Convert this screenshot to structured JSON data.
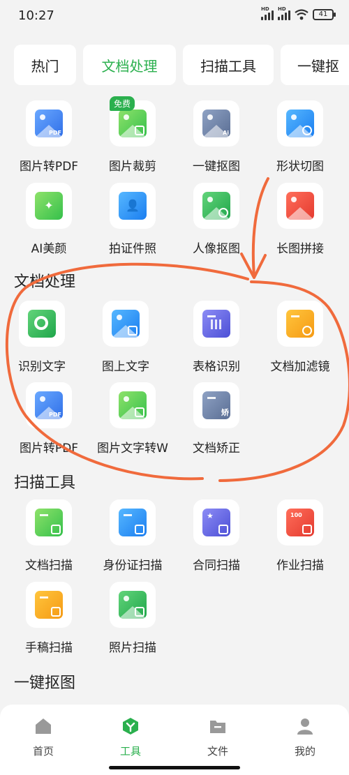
{
  "status_bar": {
    "time": "10:27",
    "signal1": "HD",
    "signal2": "HD",
    "battery": "41"
  },
  "tabs": [
    {
      "label": "热门",
      "active": false
    },
    {
      "label": "文档处理",
      "active": true
    },
    {
      "label": "扫描工具",
      "active": false
    },
    {
      "label": "一键抠",
      "active": false
    }
  ],
  "sections": {
    "doc_processing": "文档处理",
    "scan_tools": "扫描工具",
    "one_click_cutout": "一键抠图"
  },
  "hot_tools": [
    {
      "label": "图片转PDF",
      "mark": "PDF"
    },
    {
      "label": "图片裁剪",
      "badge": "免费"
    },
    {
      "label": "一键抠图",
      "mark": "Ai"
    },
    {
      "label": "形状切图"
    },
    {
      "label": "AI美颜"
    },
    {
      "label": "拍证件照"
    },
    {
      "label": "人像抠图"
    },
    {
      "label": "长图拼接"
    }
  ],
  "doc_tools": [
    {
      "label": "识别文字"
    },
    {
      "label": "图上文字"
    },
    {
      "label": "表格识别"
    },
    {
      "label": "文档加滤镜"
    },
    {
      "label": "图片转PDF",
      "mark": "PDF"
    },
    {
      "label": "图片文字转W"
    },
    {
      "label": "文档矫正",
      "mark": "矫"
    }
  ],
  "scan_tools": [
    {
      "label": "文档扫描"
    },
    {
      "label": "身份证扫描"
    },
    {
      "label": "合同扫描"
    },
    {
      "label": "作业扫描",
      "mark": "100"
    },
    {
      "label": "手稿扫描"
    },
    {
      "label": "照片扫描"
    }
  ],
  "bottom_nav": [
    {
      "label": "首页",
      "active": false
    },
    {
      "label": "工具",
      "active": true
    },
    {
      "label": "文件",
      "active": false
    },
    {
      "label": "我的",
      "active": false
    }
  ],
  "colors": {
    "accent": "#2bb04e",
    "annotation": "#f06a3c",
    "background": "#f3f3f3"
  }
}
